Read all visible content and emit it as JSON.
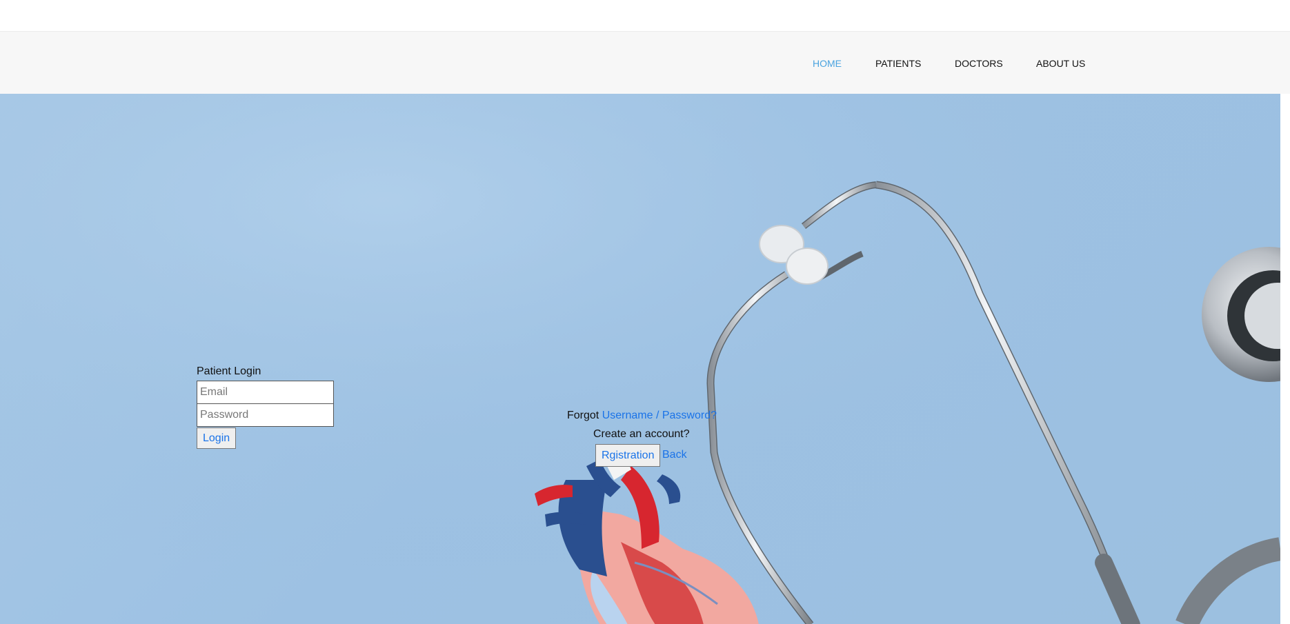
{
  "nav": {
    "items": [
      {
        "label": "HOME",
        "active": true
      },
      {
        "label": "PATIENTS",
        "active": false
      },
      {
        "label": "DOCTORS",
        "active": false
      },
      {
        "label": "ABOUT US",
        "active": false
      }
    ]
  },
  "login": {
    "title": "Patient Login",
    "email_placeholder": "Email",
    "password_placeholder": "Password",
    "login_label": "Login"
  },
  "recovery": {
    "forgot_prefix": "Forgot",
    "forgot_link": "Username / Password?",
    "create_account": "Create an account?",
    "registration_label": "Rgistration",
    "back_label": "Back"
  },
  "colors": {
    "nav_active": "#4aa3df",
    "link": "#1a73e8",
    "hero_background": "#9dc1e3"
  },
  "icons": {
    "hero": "stethoscope-and-heart-model-image"
  }
}
